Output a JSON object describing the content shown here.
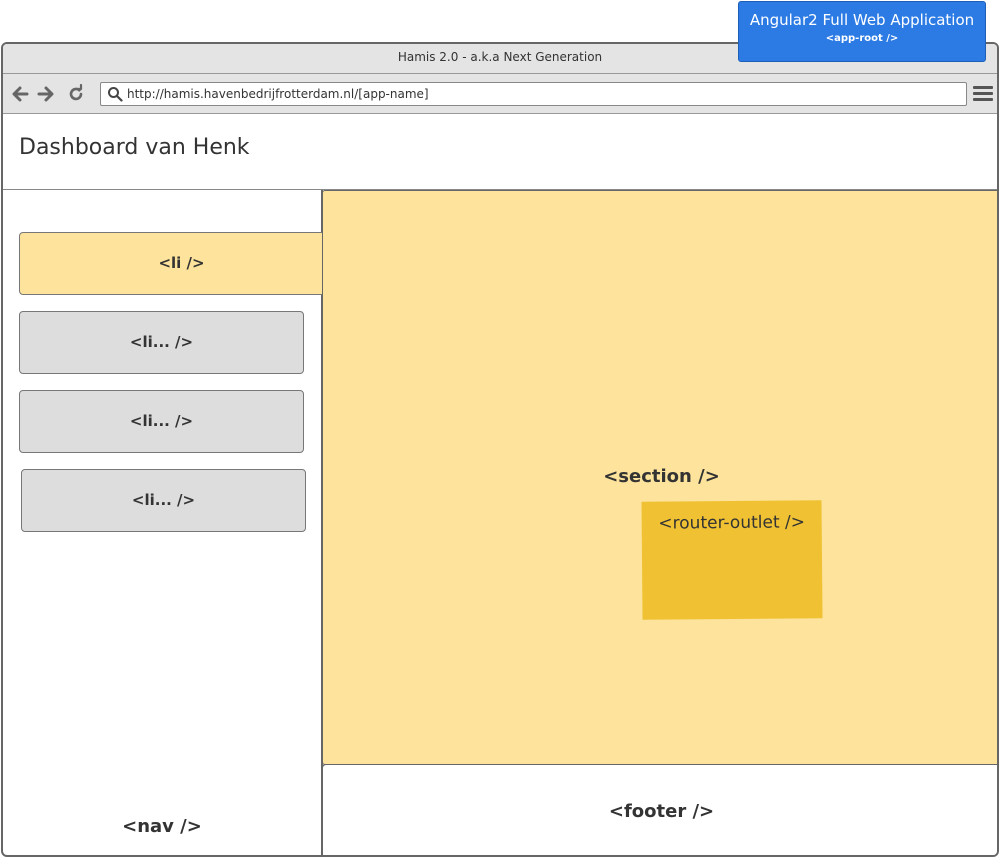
{
  "window": {
    "title": "Hamis 2.0 - a.k.a Next Generation"
  },
  "toolbar": {
    "back_icon": "arrow-left-icon",
    "forward_icon": "arrow-right-icon",
    "reload_icon": "reload-icon",
    "url": "http://hamis.havenbedrijfrotterdam.nl/[app-name]",
    "menu_icon": "hamburger-menu-icon"
  },
  "header": {
    "title": "Dashboard van Henk"
  },
  "nav": {
    "label": "<nav />",
    "items": [
      {
        "label": "<li />",
        "active": true
      },
      {
        "label": "<li... />",
        "active": false
      },
      {
        "label": "<li... />",
        "active": false
      },
      {
        "label": "<li... />",
        "active": false
      }
    ]
  },
  "section": {
    "label": "<section />",
    "outlet_label": "<router-outlet />"
  },
  "footer": {
    "label": "<footer />"
  },
  "note": {
    "title": "Angular2 Full Web Application",
    "subtitle": "<app-root />"
  },
  "colors": {
    "highlight": "#fde39b",
    "outlet": "#f0c233",
    "inactive_item": "#dddddd",
    "note": "#2c7be5"
  }
}
